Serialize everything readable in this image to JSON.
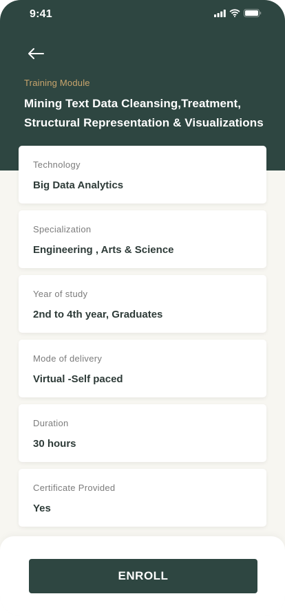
{
  "status_bar": {
    "time": "9:41",
    "icons": [
      "signal-icon",
      "wifi-icon",
      "battery-icon"
    ]
  },
  "header": {
    "back_icon": "arrow-left-icon",
    "module_label": "Training Module",
    "module_title": "Mining Text Data Cleansing,Treatment, Structural Representation & Visualizations"
  },
  "details": [
    {
      "label": "Technology",
      "value": "Big Data Analytics"
    },
    {
      "label": "Specialization",
      "value": "Engineering , Arts & Science"
    },
    {
      "label": "Year of study",
      "value": "2nd to 4th year, Graduates"
    },
    {
      "label": "Mode of delivery",
      "value": "Virtual -Self paced"
    },
    {
      "label": "Duration",
      "value": "30 hours"
    },
    {
      "label": "Certificate Provided",
      "value": "Yes"
    }
  ],
  "footer": {
    "enroll_label": "ENROLL"
  },
  "colors": {
    "primary": "#2e4641",
    "accent": "#c9a56d",
    "background": "#f7f6f1"
  }
}
